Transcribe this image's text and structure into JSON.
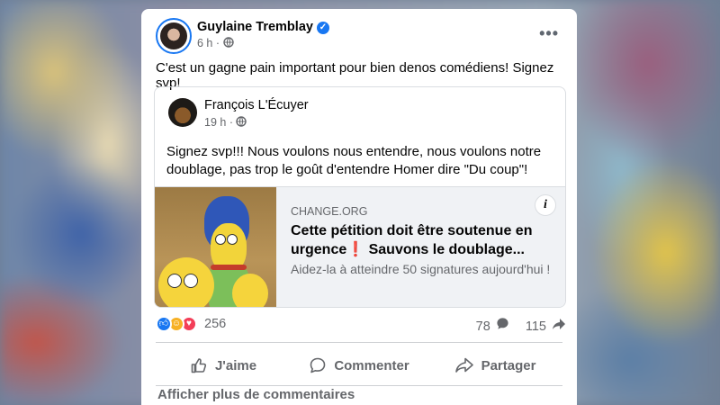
{
  "post": {
    "author": "Guylaine Tremblay",
    "time": "6 h",
    "text": "C'est un gagne pain important pour bien denos comédiens! Signez svp!"
  },
  "shared": {
    "author": "François L'Écuyer",
    "time": "19 h",
    "text": "Signez svp!!! Nous voulons nous entendre, nous voulons notre doublage, pas trop le goût d'entendre Homer dire \"Du coup\"!",
    "link": {
      "domain": "CHANGE.ORG",
      "title": "Cette pétition doit être soutenue en urgence❗ Sauvons le doublage...",
      "description": "Aidez-la à atteindre 50 signatures aujourd'hui !"
    }
  },
  "stats": {
    "reactions": 256,
    "comments": 78,
    "shares": 115
  },
  "actions": {
    "like": "J'aime",
    "comment": "Commenter",
    "share": "Partager"
  },
  "footer": {
    "more_comments": "Afficher plus de commentaires"
  },
  "icons": {
    "verified": "verified-badge-icon",
    "privacy": "globe-icon",
    "more": "more-options-icon",
    "info": "info-icon"
  },
  "colors": {
    "brand_blue": "#1877f2",
    "secondary_text": "#65676b",
    "like": "#1877f2",
    "care": "#f7b125",
    "love": "#f33e58"
  }
}
